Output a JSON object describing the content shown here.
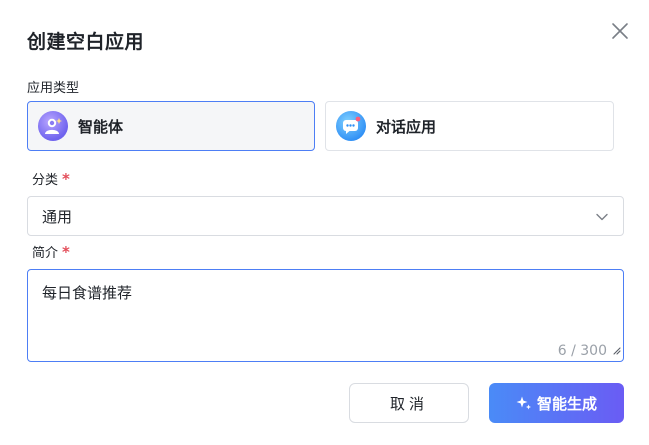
{
  "dialog": {
    "title": "创建空白应用",
    "close_icon": "close-icon"
  },
  "app_type": {
    "label": "应用类型",
    "options": [
      {
        "label": "智能体",
        "icon": "agent-avatar-icon",
        "selected": true
      },
      {
        "label": "对话应用",
        "icon": "chat-bubble-icon",
        "selected": false
      }
    ]
  },
  "category": {
    "label": "分类",
    "required_mark": "*",
    "value": "通用"
  },
  "intro": {
    "label": "简介",
    "required_mark": "*",
    "value": "每日食谱推荐",
    "counter": "6 / 300"
  },
  "actions": {
    "cancel_label": "取消",
    "generate_label": "智能生成"
  },
  "colors": {
    "accent": "#4d7ef5",
    "required": "#e34d59",
    "gradient_start": "#4a8bf7",
    "gradient_end": "#6a5cf4"
  }
}
